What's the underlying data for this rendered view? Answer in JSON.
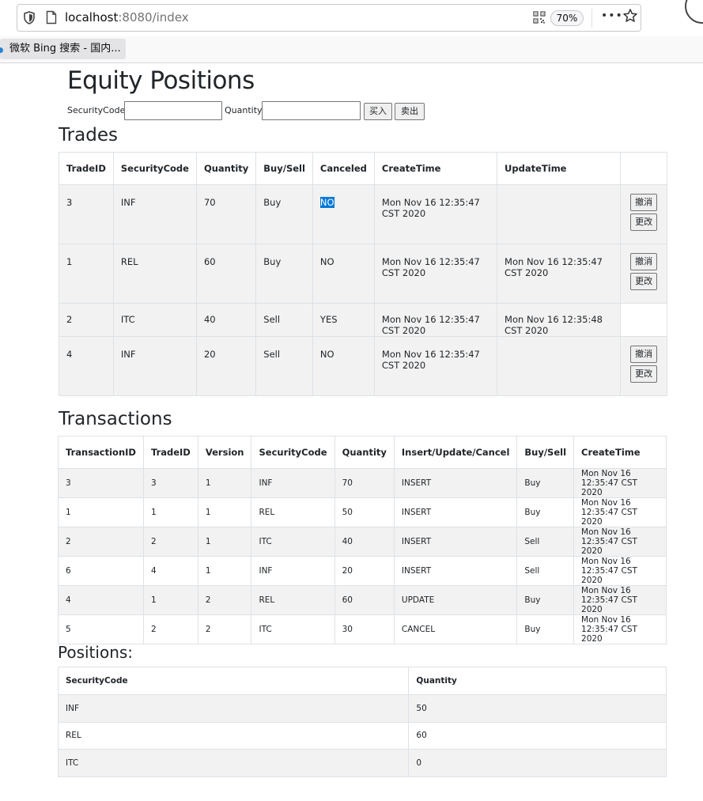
{
  "browser": {
    "url_host": "localhost",
    "url_rest": ":8080/index",
    "zoom": "70%",
    "more_label": "•••",
    "bookmark_label": "微软 Bing 搜索 - 国内..."
  },
  "page": {
    "title": "Equity Positions",
    "form": {
      "security_code_label": "SecurityCode:",
      "quantity_label": "Quantity:",
      "security_code_value": "",
      "quantity_value": "",
      "buy_label": "买入",
      "sell_label": "卖出"
    },
    "trades": {
      "heading": "Trades",
      "headers": [
        "TradeID",
        "SecurityCode",
        "Quantity",
        "Buy/Sell",
        "Canceled",
        "CreateTime",
        "UpdateTime",
        ""
      ],
      "rows": [
        {
          "id": "3",
          "code": "INF",
          "qty": "70",
          "side": "Buy",
          "canceled": "NO",
          "create": "Mon Nov 16 12:35:47 CST 2020",
          "update": "",
          "has_actions": true
        },
        {
          "id": "1",
          "code": "REL",
          "qty": "60",
          "side": "Buy",
          "canceled": "NO",
          "create": "Mon Nov 16 12:35:47 CST 2020",
          "update": "Mon Nov 16 12:35:47 CST 2020",
          "has_actions": true
        },
        {
          "id": "2",
          "code": "ITC",
          "qty": "40",
          "side": "Sell",
          "canceled": "YES",
          "create": "Mon Nov 16 12:35:47 CST 2020",
          "update": "Mon Nov 16 12:35:48 CST 2020",
          "has_actions": false
        },
        {
          "id": "4",
          "code": "INF",
          "qty": "20",
          "side": "Sell",
          "canceled": "NO",
          "create": "Mon Nov 16 12:35:47 CST 2020",
          "update": "",
          "has_actions": true
        }
      ],
      "cancel_label": "撤消",
      "modify_label": "更改"
    },
    "transactions": {
      "heading": "Transactions",
      "headers": [
        "TransactionID",
        "TradeID",
        "Version",
        "SecurityCode",
        "Quantity",
        "Insert/Update/Cancel",
        "Buy/Sell",
        "CreateTime"
      ],
      "rows": [
        [
          "3",
          "3",
          "1",
          "INF",
          "70",
          "INSERT",
          "Buy",
          "Mon Nov 16 12:35:47 CST 2020"
        ],
        [
          "1",
          "1",
          "1",
          "REL",
          "50",
          "INSERT",
          "Buy",
          "Mon Nov 16 12:35:47 CST 2020"
        ],
        [
          "2",
          "2",
          "1",
          "ITC",
          "40",
          "INSERT",
          "Sell",
          "Mon Nov 16 12:35:47 CST 2020"
        ],
        [
          "6",
          "4",
          "1",
          "INF",
          "20",
          "INSERT",
          "Sell",
          "Mon Nov 16 12:35:47 CST 2020"
        ],
        [
          "4",
          "1",
          "2",
          "REL",
          "60",
          "UPDATE",
          "Buy",
          "Mon Nov 16 12:35:47 CST 2020"
        ],
        [
          "5",
          "2",
          "2",
          "ITC",
          "30",
          "CANCEL",
          "Buy",
          "Mon Nov 16 12:35:47 CST 2020"
        ]
      ]
    },
    "positions": {
      "heading": "Positions:",
      "headers": [
        "SecurityCode",
        "Quantity"
      ],
      "rows": [
        [
          "INF",
          "50"
        ],
        [
          "REL",
          "60"
        ],
        [
          "ITC",
          "0"
        ]
      ]
    }
  }
}
